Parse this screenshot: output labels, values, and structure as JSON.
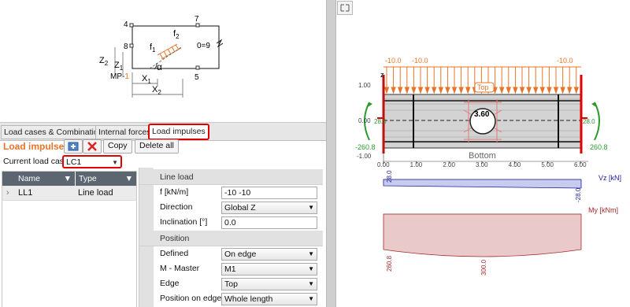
{
  "sketch": {
    "corner_labels": [
      "4",
      "7",
      "8",
      "0=9",
      "5"
    ],
    "labels": {
      "f1": "f",
      "f1_sub": "1",
      "f2": "f",
      "f2_sub": "2",
      "alpha": "α",
      "z1": "Z",
      "z1_sub": "1",
      "z2": "Z",
      "z2_sub": "2",
      "x1": "X",
      "x1_sub": "1",
      "x2": "X",
      "x2_sub": "2",
      "mp": "MP-",
      "mp_num": "1"
    }
  },
  "tabs": [
    "Load cases & Combinations",
    "Internal forces",
    "Load impulses"
  ],
  "toolbar": {
    "title": "Load impulses",
    "copy_label": "Copy",
    "delete_all_label": "Delete all"
  },
  "current_load_case": {
    "label": "Current load case",
    "value": "LC1"
  },
  "grid": {
    "headers": [
      "Name",
      "Type"
    ],
    "rows": [
      {
        "name": "LL1",
        "type": "Line load"
      }
    ]
  },
  "properties": {
    "section_line_load": "Line load",
    "f_label": "f [kN/m]",
    "f_value": "-10 -10",
    "direction_label": "Direction",
    "direction_value": "Global Z",
    "inclination_label": "Inclination [°]",
    "inclination_value": "0.0",
    "section_position": "Position",
    "defined_label": "Defined",
    "defined_value": "On edge",
    "master_label": "M - Master",
    "master_value": "M1",
    "edge_label": "Edge",
    "edge_value": "Top",
    "pos_on_edge_label": "Position on edge",
    "pos_on_edge_value": "Whole length"
  },
  "diagram": {
    "load_labels": [
      "-10.0",
      "-10.0",
      "-10.0"
    ],
    "top_label": "Top",
    "bottom_label": "Bottom",
    "center_value": "3.60",
    "left_reaction": "-260.8",
    "right_reaction": "260.8",
    "left_mid": "28.0",
    "right_mid": "28.0",
    "axis_z": "z",
    "y_ticks": [
      "1.00",
      "0.00",
      "-1.00"
    ],
    "x_ticks": [
      "0.00",
      "1.00",
      "2.00",
      "3.00",
      "4.00",
      "5.00",
      "6.00"
    ],
    "vz_label": "Vz [kN]",
    "vz_left": "28.0",
    "vz_right": "-28.0",
    "my_label": "My [kNm]",
    "my_left": "260.8",
    "my_mid": "300.0"
  },
  "colors": {
    "accent_orange": "#e8742a",
    "highlight_red": "#e00000",
    "header_slate": "#5b6670",
    "shear_blue": "#1c1c9c",
    "moment_red": "#a52a2a"
  }
}
